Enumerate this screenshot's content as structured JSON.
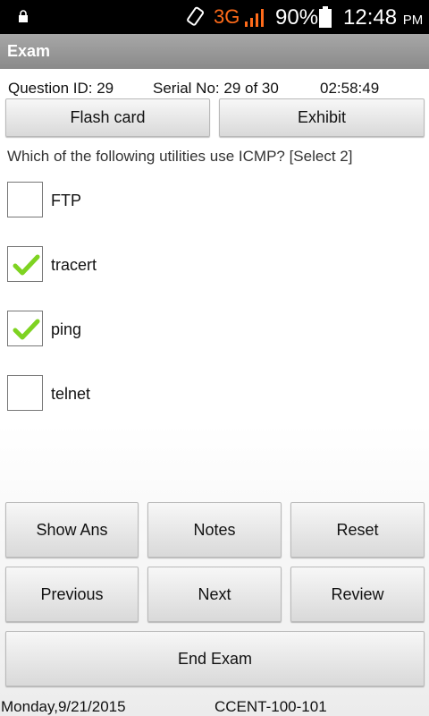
{
  "status_bar": {
    "network": "3G",
    "battery_percent": "90%",
    "time": "12:48",
    "ampm": "PM",
    "icons": [
      "lock-icon",
      "rotate-icon",
      "signal-icon",
      "battery-icon"
    ],
    "network_color": "#ff6b1a"
  },
  "app_title": "Exam",
  "info": {
    "question_id": "Question ID: 29",
    "serial": "Serial No: 29 of 30",
    "timer": "02:58:49"
  },
  "top_buttons": {
    "flash_card": "Flash card",
    "exhibit": "Exhibit"
  },
  "question": "Which of the following utilities use ICMP? [Select 2]",
  "options": [
    {
      "label": "FTP",
      "checked": false
    },
    {
      "label": "tracert",
      "checked": true
    },
    {
      "label": "ping",
      "checked": true
    },
    {
      "label": "telnet",
      "checked": false
    }
  ],
  "buttons": {
    "show_ans": "Show Ans",
    "notes": "Notes",
    "reset": "Reset",
    "previous": "Previous",
    "next": "Next",
    "review": "Review",
    "end_exam": "End Exam"
  },
  "footer": {
    "date": "Monday,9/21/2015",
    "exam_code": "CCENT-100-101"
  },
  "colors": {
    "check": "#7ed321",
    "action_bar": "#9a9a9a"
  }
}
